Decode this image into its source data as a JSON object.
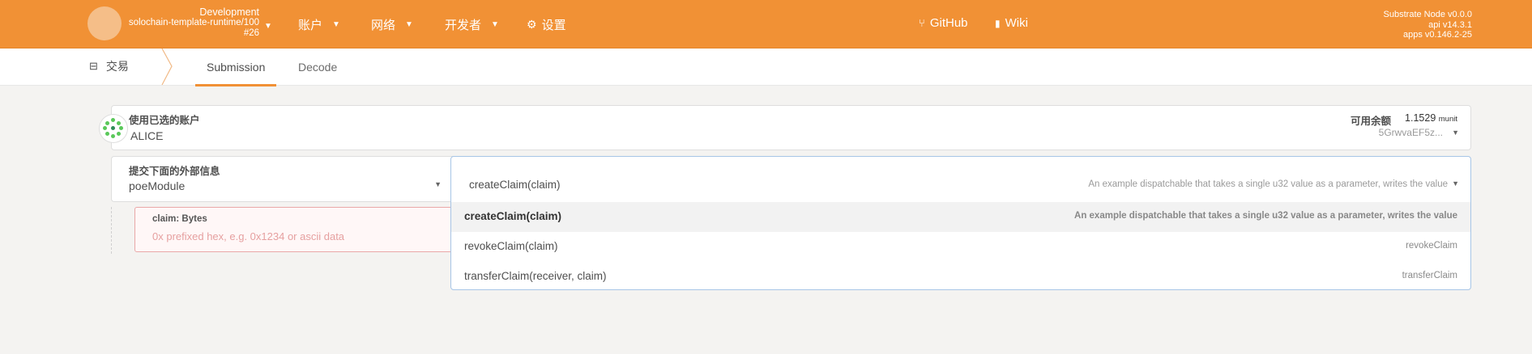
{
  "topbar": {
    "chain_env": "Development",
    "chain_runtime": "solochain-template-runtime/100",
    "chain_block": "#26",
    "menu": [
      {
        "label": "账户"
      },
      {
        "label": "网络"
      },
      {
        "label": "开发者"
      },
      {
        "label": "设置"
      }
    ],
    "links": [
      {
        "label": "GitHub"
      },
      {
        "label": "Wiki"
      }
    ],
    "node_name": "Substrate Node v0.0.0",
    "api_version": "api v14.3.1",
    "apps_version": "apps v0.146.2-25"
  },
  "subbar": {
    "section": "交易",
    "tabs": [
      {
        "label": "Submission"
      },
      {
        "label": "Decode"
      }
    ]
  },
  "account": {
    "label": "使用已选的账户",
    "name": "ALICE",
    "balance_label": "可用余额",
    "balance_value": "1.1529",
    "balance_unit": "munit",
    "address": "5GrwvaEF5z..."
  },
  "extrinsic": {
    "label": "提交下面的外部信息",
    "module": "poeModule",
    "selected_call": "createClaim(claim)",
    "selected_desc": "An example dispatchable that takes a single u32 value as a parameter, writes the value",
    "options": [
      {
        "name": "createClaim(claim)",
        "desc": "An example dispatchable that takes a single u32 value as a parameter, writes the value"
      },
      {
        "name": "revokeClaim(claim)",
        "desc": "revokeClaim"
      },
      {
        "name": "transferClaim(receiver, claim)",
        "desc": "transferClaim"
      }
    ]
  },
  "param": {
    "label": "claim: Bytes",
    "placeholder": "0x prefixed hex, e.g. 0x1234 or ascii data"
  },
  "colors": {
    "accent": "#f19135",
    "error_border": "#e9a8a8",
    "focus_border": "#a7c5e6"
  }
}
